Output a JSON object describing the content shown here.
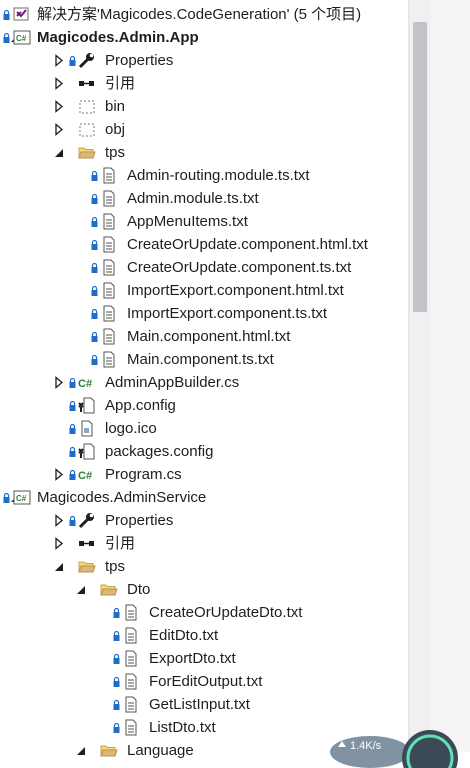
{
  "colors": {
    "accent": "#1e6ec8",
    "csharp": "#2f7d3a",
    "folder": "#dcb67a",
    "scrollbar_thumb": "#c2c3c9"
  },
  "network": {
    "speed": "1.4K/s"
  },
  "tree": [
    {
      "id": "solution",
      "depth": 0,
      "expander": "none",
      "lock": true,
      "icon": "solution-icon",
      "label": "解决方案'Magicodes.CodeGeneration' (5 个项目)",
      "bold": false
    },
    {
      "id": "project-admin-app",
      "depth": 0,
      "expander": "expanded",
      "lock": true,
      "icon": "csharp-project-icon",
      "label": "Magicodes.Admin.App",
      "bold": true
    },
    {
      "id": "properties-1",
      "depth": 1,
      "expander": "collapsed",
      "lock": true,
      "icon": "wrench-icon",
      "label": "Properties",
      "bold": false
    },
    {
      "id": "references-1",
      "depth": 1,
      "expander": "collapsed",
      "lock": false,
      "icon": "references-icon",
      "label": "引用",
      "bold": false
    },
    {
      "id": "bin",
      "depth": 1,
      "expander": "collapsed",
      "lock": false,
      "icon": "dashed-folder-icon",
      "label": "bin",
      "bold": false
    },
    {
      "id": "obj",
      "depth": 1,
      "expander": "collapsed",
      "lock": false,
      "icon": "dashed-folder-icon",
      "label": "obj",
      "bold": false
    },
    {
      "id": "tps-1",
      "depth": 1,
      "expander": "expanded",
      "lock": false,
      "icon": "folder-open-icon",
      "label": "tps",
      "bold": false
    },
    {
      "id": "f1",
      "depth": 2,
      "expander": "none",
      "lock": true,
      "icon": "file-icon",
      "label": "Admin-routing.module.ts.txt",
      "bold": false
    },
    {
      "id": "f2",
      "depth": 2,
      "expander": "none",
      "lock": true,
      "icon": "file-icon",
      "label": "Admin.module.ts.txt",
      "bold": false
    },
    {
      "id": "f3",
      "depth": 2,
      "expander": "none",
      "lock": true,
      "icon": "file-icon",
      "label": "AppMenuItems.txt",
      "bold": false
    },
    {
      "id": "f4",
      "depth": 2,
      "expander": "none",
      "lock": true,
      "icon": "file-icon",
      "label": "CreateOrUpdate.component.html.txt",
      "bold": false
    },
    {
      "id": "f5",
      "depth": 2,
      "expander": "none",
      "lock": true,
      "icon": "file-icon",
      "label": "CreateOrUpdate.component.ts.txt",
      "bold": false
    },
    {
      "id": "f6",
      "depth": 2,
      "expander": "none",
      "lock": true,
      "icon": "file-icon",
      "label": "ImportExport.component.html.txt",
      "bold": false
    },
    {
      "id": "f7",
      "depth": 2,
      "expander": "none",
      "lock": true,
      "icon": "file-icon",
      "label": "ImportExport.component.ts.txt",
      "bold": false
    },
    {
      "id": "f8",
      "depth": 2,
      "expander": "none",
      "lock": true,
      "icon": "file-icon",
      "label": "Main.component.html.txt",
      "bold": false
    },
    {
      "id": "f9",
      "depth": 2,
      "expander": "none",
      "lock": true,
      "icon": "file-icon",
      "label": "Main.component.ts.txt",
      "bold": false
    },
    {
      "id": "adminappbuilder",
      "depth": 1,
      "expander": "collapsed",
      "lock": true,
      "icon": "csharp-file-icon",
      "label": "AdminAppBuilder.cs",
      "bold": false
    },
    {
      "id": "appconfig",
      "depth": 1,
      "expander": "none",
      "lock": true,
      "icon": "config-icon",
      "label": "App.config",
      "bold": false
    },
    {
      "id": "logo",
      "depth": 1,
      "expander": "none",
      "lock": true,
      "icon": "ico-file-icon",
      "label": "logo.ico",
      "bold": false
    },
    {
      "id": "packagesconfig",
      "depth": 1,
      "expander": "none",
      "lock": true,
      "icon": "config-icon",
      "label": "packages.config",
      "bold": false
    },
    {
      "id": "program",
      "depth": 1,
      "expander": "collapsed",
      "lock": true,
      "icon": "csharp-file-icon",
      "label": "Program.cs",
      "bold": false
    },
    {
      "id": "project-adminservice",
      "depth": 0,
      "expander": "expanded",
      "lock": true,
      "icon": "csharp-project-icon",
      "label": "Magicodes.AdminService",
      "bold": false
    },
    {
      "id": "properties-2",
      "depth": 1,
      "expander": "collapsed",
      "lock": true,
      "icon": "wrench-icon",
      "label": "Properties",
      "bold": false
    },
    {
      "id": "references-2",
      "depth": 1,
      "expander": "collapsed",
      "lock": false,
      "icon": "references-icon",
      "label": "引用",
      "bold": false
    },
    {
      "id": "tps-2",
      "depth": 1,
      "expander": "expanded",
      "lock": false,
      "icon": "folder-open-icon",
      "label": "tps",
      "bold": false
    },
    {
      "id": "dto",
      "depth": 2,
      "expander": "expanded",
      "lock": false,
      "icon": "folder-open-icon",
      "label": "Dto",
      "bold": false
    },
    {
      "id": "d1",
      "depth": 3,
      "expander": "none",
      "lock": true,
      "icon": "file-icon",
      "label": "CreateOrUpdateDto.txt",
      "bold": false
    },
    {
      "id": "d2",
      "depth": 3,
      "expander": "none",
      "lock": true,
      "icon": "file-icon",
      "label": "EditDto.txt",
      "bold": false
    },
    {
      "id": "d3",
      "depth": 3,
      "expander": "none",
      "lock": true,
      "icon": "file-icon",
      "label": "ExportDto.txt",
      "bold": false
    },
    {
      "id": "d4",
      "depth": 3,
      "expander": "none",
      "lock": true,
      "icon": "file-icon",
      "label": "ForEditOutput.txt",
      "bold": false
    },
    {
      "id": "d5",
      "depth": 3,
      "expander": "none",
      "lock": true,
      "icon": "file-icon",
      "label": "GetListInput.txt",
      "bold": false
    },
    {
      "id": "d6",
      "depth": 3,
      "expander": "none",
      "lock": true,
      "icon": "file-icon",
      "label": "ListDto.txt",
      "bold": false
    },
    {
      "id": "language",
      "depth": 2,
      "expander": "expanded",
      "lock": false,
      "icon": "folder-open-icon",
      "label": "Language",
      "bold": false
    }
  ]
}
